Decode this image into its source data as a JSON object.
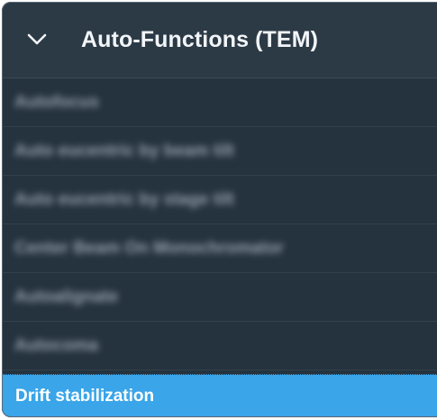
{
  "panel": {
    "title": "Auto-Functions (TEM)",
    "expanded_icon": "chevron-down-icon",
    "items": [
      {
        "label": "Autofocus",
        "selected": false
      },
      {
        "label": "Auto eucentric by beam tilt",
        "selected": false
      },
      {
        "label": "Auto eucentric by stage tilt",
        "selected": false
      },
      {
        "label": "Center Beam On Monochromator",
        "selected": false
      },
      {
        "label": "Autoalignate",
        "selected": false
      },
      {
        "label": "Autocoma",
        "selected": false
      },
      {
        "label": "Drift stabilization",
        "selected": true
      }
    ]
  },
  "colors": {
    "panel_bg": "#25333f",
    "header_bg": "#2c3a46",
    "selected_bg": "#3aa5e8",
    "text": "#f2f5f8"
  }
}
